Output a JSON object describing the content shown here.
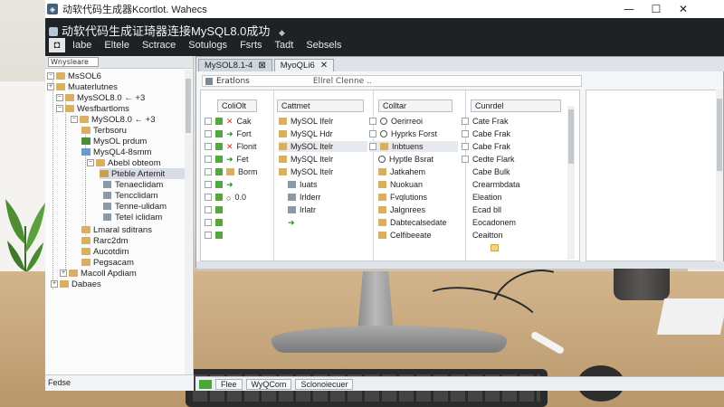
{
  "window": {
    "title": "动软代码生成器Kcortlot. Wahecs",
    "conn_title": "动软代码生成证琦器连接MySQL8.0成功"
  },
  "menu": [
    "Iabe",
    "Eltele",
    "Sctrace",
    "Sotulogs",
    "Fsrts",
    "Tadt",
    "Sebsels"
  ],
  "nav": {
    "selector": "Wnysleare",
    "items": [
      {
        "label": "MsSOL6 "
      },
      {
        "label": "Muaterlutnes"
      },
      {
        "label": "MysSOL8.0 ← +3"
      },
      {
        "label": "Wesfbartloms"
      },
      {
        "label": "MySOL8.0 ← +3"
      },
      {
        "label": "Terbsoru"
      },
      {
        "label": "MysOL prdum"
      },
      {
        "label": "MysQL4-8smm"
      },
      {
        "label": "Abebl obteom"
      },
      {
        "label": "Pteble Artemit"
      },
      {
        "label": "Tenaeclidam"
      },
      {
        "label": "Tencclidam"
      },
      {
        "label": "Tenne-ulidam"
      },
      {
        "label": "Tetel iclidam"
      },
      {
        "label": "Lmaral sditrans"
      },
      {
        "label": "Rarc2dm"
      },
      {
        "label": "Aucotdim"
      },
      {
        "label": "Pegsacam"
      },
      {
        "label": "Macoll Apdiam"
      },
      {
        "label": "Dabaes"
      }
    ],
    "footer": "Fedse"
  },
  "pane": {
    "tabs": [
      {
        "label": "MySOL8.1-4",
        "close": "⊠"
      },
      {
        "label": "MyoQLi6",
        "close": "✕"
      }
    ],
    "toolbar": {
      "text": "Eratlons",
      "search": "Ellrel Clenne .."
    },
    "headers": [
      "ColiOlt",
      "Cattmet",
      "Colltar",
      "Cunrdel"
    ],
    "col1": [
      "Cak",
      "Fort",
      "Flonit",
      "Fet",
      "Borm",
      "",
      "0.0",
      ""
    ],
    "col2": [
      "MySOL Ifelr",
      "MySQL Hdr",
      "MySOL Itelr",
      "MySQL Itelr",
      "MySOL Itelr",
      "Iuats",
      "Irlderr",
      "Irlatr",
      ""
    ],
    "col3": [
      "Oerirreoi",
      "Hyprks Forst",
      "Inbtuens",
      "Hyptle Bsrat",
      "Jatkahem",
      "Nuokuan",
      "Fvqlutions",
      "Jalgnrees",
      "Dabtecalsedate",
      "Celfibeeate"
    ],
    "col4": [
      "Cate Frak",
      "Cabe Frak",
      "Cabe Frak",
      "Cedte Flark",
      "Cabe Bulk",
      "Crearmbdata",
      "Eleation",
      "Ecad bll",
      "Eocadonem",
      "Ceaitton"
    ]
  },
  "status": {
    "tab1": "Flee",
    "tab2": "WyQCom",
    "tab3": "Sclonoiecuer"
  }
}
